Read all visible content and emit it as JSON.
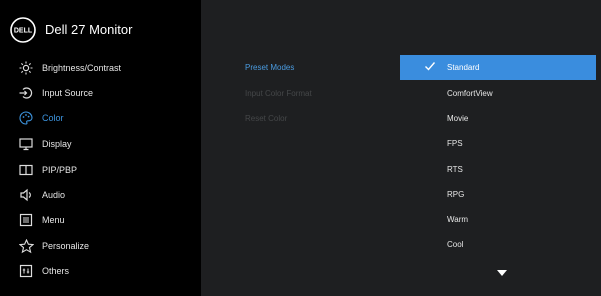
{
  "app": {
    "title": "Dell 27 Monitor",
    "logo_text": "DELL"
  },
  "menu": [
    {
      "label": "Brightness/Contrast",
      "icon": "brightness-icon"
    },
    {
      "label": "Input Source",
      "icon": "input-source-icon"
    },
    {
      "label": "Color",
      "icon": "color-icon",
      "active": true
    },
    {
      "label": "Display",
      "icon": "display-icon"
    },
    {
      "label": "PIP/PBP",
      "icon": "pip-pbp-icon"
    },
    {
      "label": "Audio",
      "icon": "audio-icon"
    },
    {
      "label": "Menu",
      "icon": "menu-icon"
    },
    {
      "label": "Personalize",
      "icon": "star-icon"
    },
    {
      "label": "Others",
      "icon": "others-icon"
    }
  ],
  "submenu": {
    "preset_modes": "Preset Modes",
    "input_color_format": "Input Color Format",
    "reset_color": "Reset Color"
  },
  "options": [
    {
      "label": "Standard",
      "selected": true
    },
    {
      "label": "ComfortView"
    },
    {
      "label": "Movie"
    },
    {
      "label": "FPS"
    },
    {
      "label": "RTS"
    },
    {
      "label": "RPG"
    },
    {
      "label": "Warm"
    },
    {
      "label": "Cool"
    }
  ],
  "colors": {
    "accent": "#3a8dde",
    "active_text": "#3d95e0",
    "panel": "#1e1f21",
    "sidebar": "#000000"
  },
  "scroll_indicator": "chevron-down-icon"
}
